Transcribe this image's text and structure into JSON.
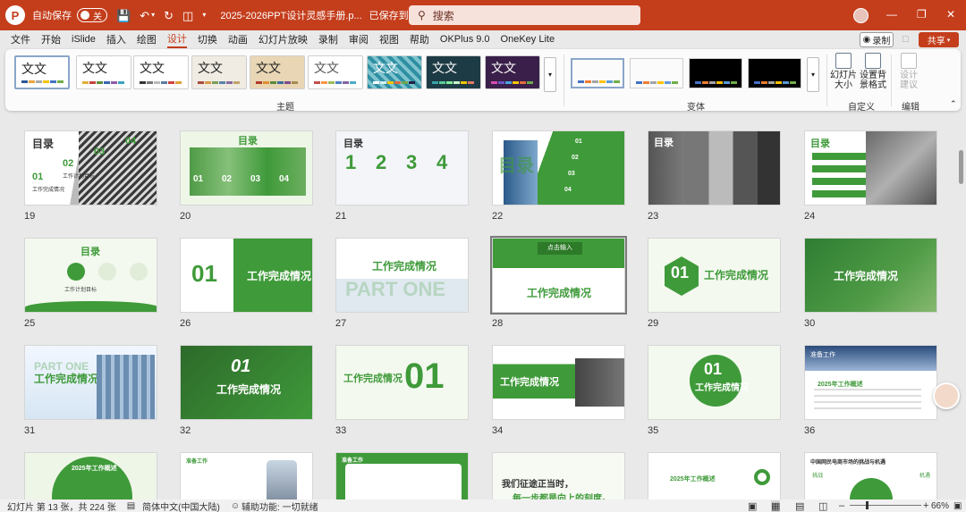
{
  "titlebar": {
    "logo": "P",
    "autosave_label": "自动保存",
    "autosave_state": "关",
    "save_icon": "save-icon",
    "file_name": "2025-2026PPT设计灵感手册.p...",
    "saved_status": "已保存到这台电脑",
    "search_placeholder": "搜索"
  },
  "menu": [
    "文件",
    "开始",
    "iSlide",
    "插入",
    "绘图",
    "设计",
    "切换",
    "动画",
    "幻灯片放映",
    "录制",
    "审阅",
    "视图",
    "帮助",
    "OKPlus 9.0",
    "OneKey Lite"
  ],
  "active_menu": "设计",
  "record_label": "录制",
  "share_label": "共享",
  "ribbon": {
    "themes_label": "主题",
    "variants_label": "变体",
    "customize_label": "自定义",
    "edit_label": "编辑",
    "theme_text": "文文",
    "slide_size": [
      "幻灯片",
      "大小"
    ],
    "bg_format": [
      "设置背",
      "景格式"
    ],
    "design_ideas": [
      "设计",
      "建议"
    ]
  },
  "slides": [
    {
      "num": "19",
      "title": "目录"
    },
    {
      "num": "20",
      "title": "目录"
    },
    {
      "num": "21",
      "title": "目录"
    },
    {
      "num": "22",
      "title": "目录"
    },
    {
      "num": "23",
      "title": "目录"
    },
    {
      "num": "24",
      "title": "目录"
    },
    {
      "num": "25",
      "title": "目录"
    },
    {
      "num": "26",
      "title": "工作完成情况"
    },
    {
      "num": "27",
      "title": "工作完成情况"
    },
    {
      "num": "28",
      "title": "工作完成情况"
    },
    {
      "num": "29",
      "title": "工作完成情况"
    },
    {
      "num": "30",
      "title": "工作完成情况"
    },
    {
      "num": "31",
      "title": "工作完成情况"
    },
    {
      "num": "32",
      "title": "工作完成情况"
    },
    {
      "num": "33",
      "title": "工作完成情况"
    },
    {
      "num": "34",
      "title": "工作完成情况"
    },
    {
      "num": "35",
      "title": "工作完成情况"
    },
    {
      "num": "36",
      "title": "准备工作"
    },
    {
      "num": "37",
      "title": "2025年工作概述"
    },
    {
      "num": "38",
      "title": "准备工作"
    },
    {
      "num": "39",
      "title": "准备工作"
    },
    {
      "num": "40",
      "title": "我们征途正当时，"
    },
    {
      "num": "41",
      "title": "2025年工作概述"
    },
    {
      "num": "42",
      "title": "中国网民电商市场的挑战与机遇"
    }
  ],
  "slide_texts": {
    "part_one": "PART ONE",
    "num01": "01",
    "digits": [
      "1",
      "2",
      "3",
      "4"
    ],
    "slide22_items": [
      "01",
      "02",
      "03",
      "04"
    ],
    "slide20_items": [
      "01",
      "02",
      "03",
      "04"
    ],
    "slide19_items": [
      "01",
      "02",
      "03",
      "04"
    ],
    "slide19_labels": [
      "工作完成情况",
      "工作计划目标"
    ],
    "slide25_labels": [
      "工作计划目标"
    ],
    "slide36_title": "2025年工作概述",
    "slide36_sub": "准备工作",
    "slide40_line2": "每一步都是向上的刻度。",
    "slide42_title": "中国网民电商市场的挑战与机遇",
    "slide42_labels": [
      "挑战",
      "机遇"
    ],
    "slide28_badge": "点击输入"
  },
  "statusbar": {
    "slide_info": "幻灯片 第 13 张，共 224 张",
    "language": "简体中文(中国大陆)",
    "accessibility": "辅助功能: 一切就绪",
    "zoom": "66%"
  },
  "colors": {
    "brand": "#c43e1c",
    "green": "#3f9a3a",
    "light_green": "#e9f4e3"
  }
}
